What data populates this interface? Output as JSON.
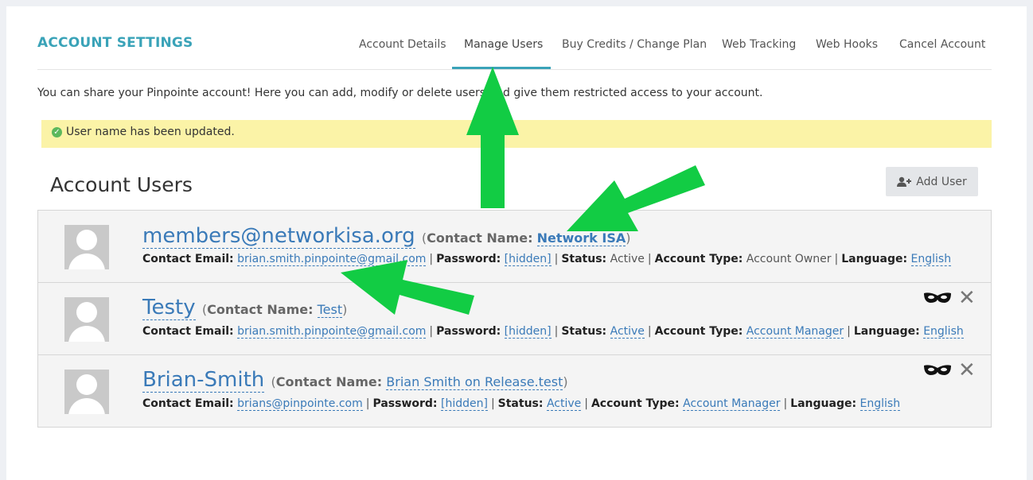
{
  "header": {
    "title": "ACCOUNT SETTINGS",
    "tabs": [
      {
        "label": "Account Details"
      },
      {
        "label": "Manage Users"
      },
      {
        "label": "Buy Credits / Change Plan"
      },
      {
        "label": "Web Tracking"
      },
      {
        "label": "Web Hooks"
      },
      {
        "label": "Cancel Account"
      }
    ],
    "active_tab": "Manage Users"
  },
  "intro_text": "You can share your Pinpointe account! Here you can add, modify or delete users and give them restricted access to your account.",
  "alert": {
    "text": "User name has been updated.",
    "icon": "check-circle-icon"
  },
  "section": {
    "title": "Account Users",
    "add_user_label": "Add User"
  },
  "labels": {
    "contact_name": "Contact Name:",
    "contact_email": "Contact Email:",
    "password": "Password:",
    "status": "Status:",
    "account_type": "Account Type:",
    "language": "Language:"
  },
  "users": [
    {
      "username": "members@networkisa.org",
      "contact_name": "Network ISA",
      "contact_email": "brian.smith.pinpointe@gmail.com",
      "password": "[hidden]",
      "status": "Active",
      "account_type": "Account Owner",
      "language": "English"
    },
    {
      "username": "Testy",
      "contact_name": "Test",
      "contact_email": "brian.smith.pinpointe@gmail.com",
      "password": "[hidden]",
      "status": "Active",
      "account_type": "Account Manager",
      "language": "English"
    },
    {
      "username": "Brian-Smith",
      "contact_name": "Brian Smith on Release.test",
      "contact_email": "brians@pinpointe.com",
      "password": "[hidden]",
      "status": "Active",
      "account_type": "Account Manager",
      "language": "English"
    }
  ],
  "colors": {
    "accent": "#3aa3b8",
    "link": "#3a7ab8",
    "alert_bg": "#fbf3a7",
    "annotation_arrow": "#12cc44"
  }
}
